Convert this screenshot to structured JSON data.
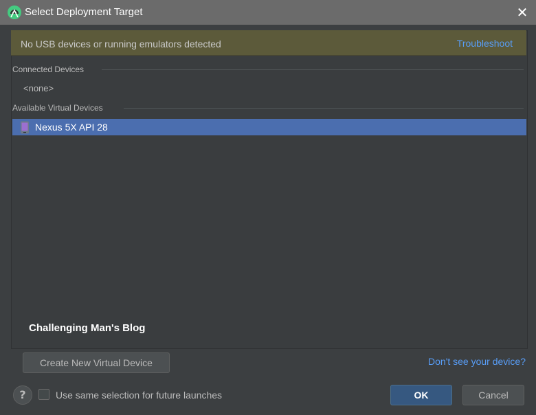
{
  "window": {
    "title": "Select Deployment Target"
  },
  "warning": {
    "message": "No USB devices or running emulators detected",
    "link": "Troubleshoot"
  },
  "sections": {
    "connected": {
      "label": "Connected Devices",
      "empty_text": "<none>"
    },
    "virtual": {
      "label": "Available Virtual Devices",
      "devices": [
        {
          "name": "Nexus 5X API 28",
          "selected": true
        }
      ]
    }
  },
  "watermark": "Challenging Man's Blog",
  "actions": {
    "create_label": "Create New Virtual Device",
    "dont_see_label": "Don't see your device?",
    "help_label": "?",
    "checkbox_label": "Use same selection for future launches",
    "checkbox_checked": false,
    "ok_label": "OK",
    "cancel_label": "Cancel"
  },
  "colors": {
    "selection": "#4b6eaf",
    "link": "#589df6",
    "warning_bg": "#5c5a3a",
    "dialog_bg": "#3c3f41",
    "titlebar_bg": "#6b6b6b",
    "android_green": "#a4c639"
  },
  "icons": {
    "app": "android-studio-icon",
    "close": "close-icon",
    "device": "phone-icon"
  }
}
